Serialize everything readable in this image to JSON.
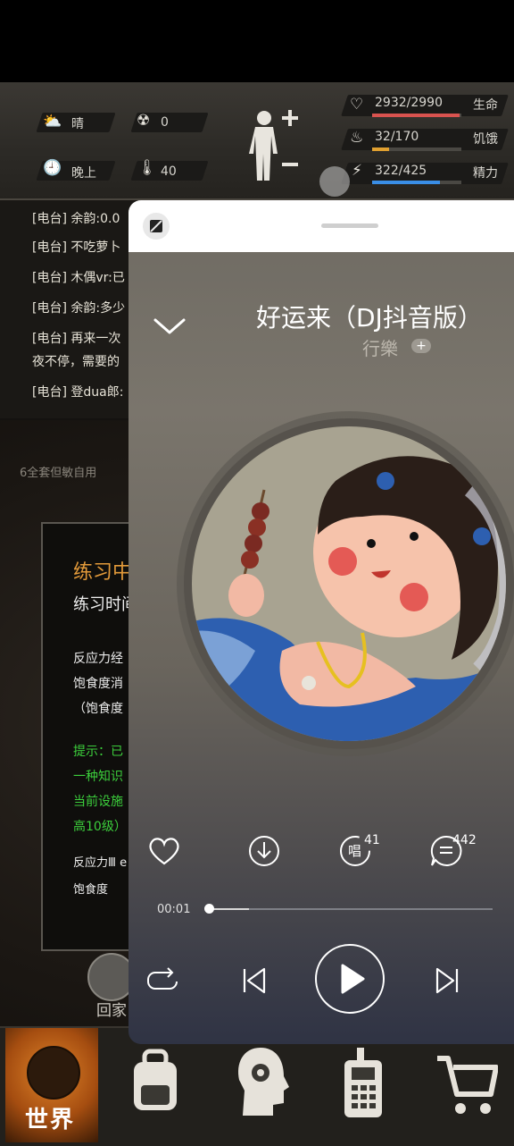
{
  "hud": {
    "weather": "晴",
    "radiation": "0",
    "time_of_day": "晚上",
    "temperature": "40",
    "health": {
      "value": "2932/2990",
      "label": "生命",
      "fraction": 0.98,
      "color": "#d9534f"
    },
    "hunger": {
      "value": "32/170",
      "label": "饥饿",
      "fraction": 0.19,
      "color": "#e0a030"
    },
    "energy": {
      "value": "322/425",
      "label": "精力",
      "fraction": 0.76,
      "color": "#3a8ee6"
    }
  },
  "chat": {
    "lines": [
      "[电台] 余韵:0.0",
      "[电台] 不吃萝卜",
      "[电台] 木偶vr:已",
      "[电台] 余韵:多少",
      "[电台] 再来一次",
      "夜不停，需要的",
      "[电台] 登dua郎:"
    ]
  },
  "game_panel": {
    "header_note": "6全套但敏自用",
    "title": "练习中",
    "time_label": "练习时间",
    "line1": "反应力经",
    "line2": "饱食度消",
    "line3": "（饱食度",
    "tip1": "提示：已",
    "tip2": "一种知识",
    "tip3": "当前设施",
    "tip4": "高10级）",
    "line4": "反应力Ⅲ e",
    "line5": "饱食度",
    "home_label": "回家"
  },
  "bottom_nav": {
    "world_label": "世界",
    "items": [
      "backpack-icon",
      "skills-icon",
      "radio-icon",
      "shop-icon"
    ]
  },
  "player": {
    "song_title": "好运来（DJ抖音版）",
    "artist": "行樂",
    "artist_badge": "+",
    "sing_count": "41",
    "sing_label": "唱",
    "comment_count": "442",
    "current_time": "00:01",
    "progress": 0.14
  }
}
